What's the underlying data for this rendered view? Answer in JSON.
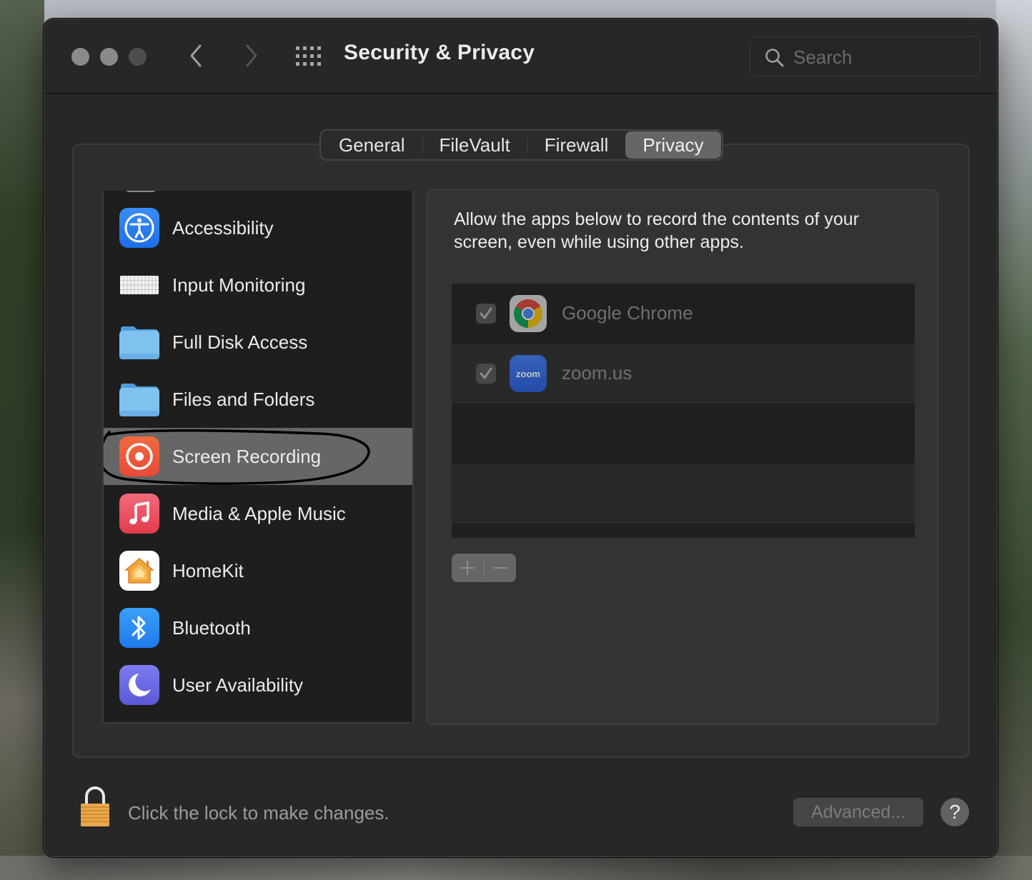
{
  "window": {
    "title": "Security & Privacy",
    "search_placeholder": "Search"
  },
  "tabs": [
    {
      "label": "General",
      "active": false
    },
    {
      "label": "FileVault",
      "active": false
    },
    {
      "label": "Firewall",
      "active": false
    },
    {
      "label": "Privacy",
      "active": true
    }
  ],
  "sidebar": {
    "items": [
      {
        "label": "Accessibility",
        "icon": "accessibility-icon",
        "selected": false
      },
      {
        "label": "Input Monitoring",
        "icon": "keyboard-icon",
        "selected": false
      },
      {
        "label": "Full Disk Access",
        "icon": "folder-icon",
        "selected": false
      },
      {
        "label": "Files and Folders",
        "icon": "folder-icon",
        "selected": false
      },
      {
        "label": "Screen Recording",
        "icon": "screen-recording-icon",
        "selected": true
      },
      {
        "label": "Media & Apple Music",
        "icon": "music-note-icon",
        "selected": false
      },
      {
        "label": "HomeKit",
        "icon": "home-icon",
        "selected": false
      },
      {
        "label": "Bluetooth",
        "icon": "bluetooth-icon",
        "selected": false
      },
      {
        "label": "User Availability",
        "icon": "moon-icon",
        "selected": false
      }
    ]
  },
  "detail": {
    "description": "Allow the apps below to record the contents of your screen, even while using other apps.",
    "apps": [
      {
        "name": "Google Chrome",
        "checked": true,
        "icon": "chrome-icon"
      },
      {
        "name": "zoom.us",
        "checked": true,
        "icon": "zoom-icon",
        "icon_text": "zoom"
      }
    ],
    "add_label": "+",
    "remove_label": "−"
  },
  "footer": {
    "lock_text": "Click the lock to make changes.",
    "advanced_label": "Advanced...",
    "help_label": "?"
  },
  "colors": {
    "selected_row": "#666666",
    "window_bg": "#272727",
    "zoom_blue": "#2d64d8"
  }
}
